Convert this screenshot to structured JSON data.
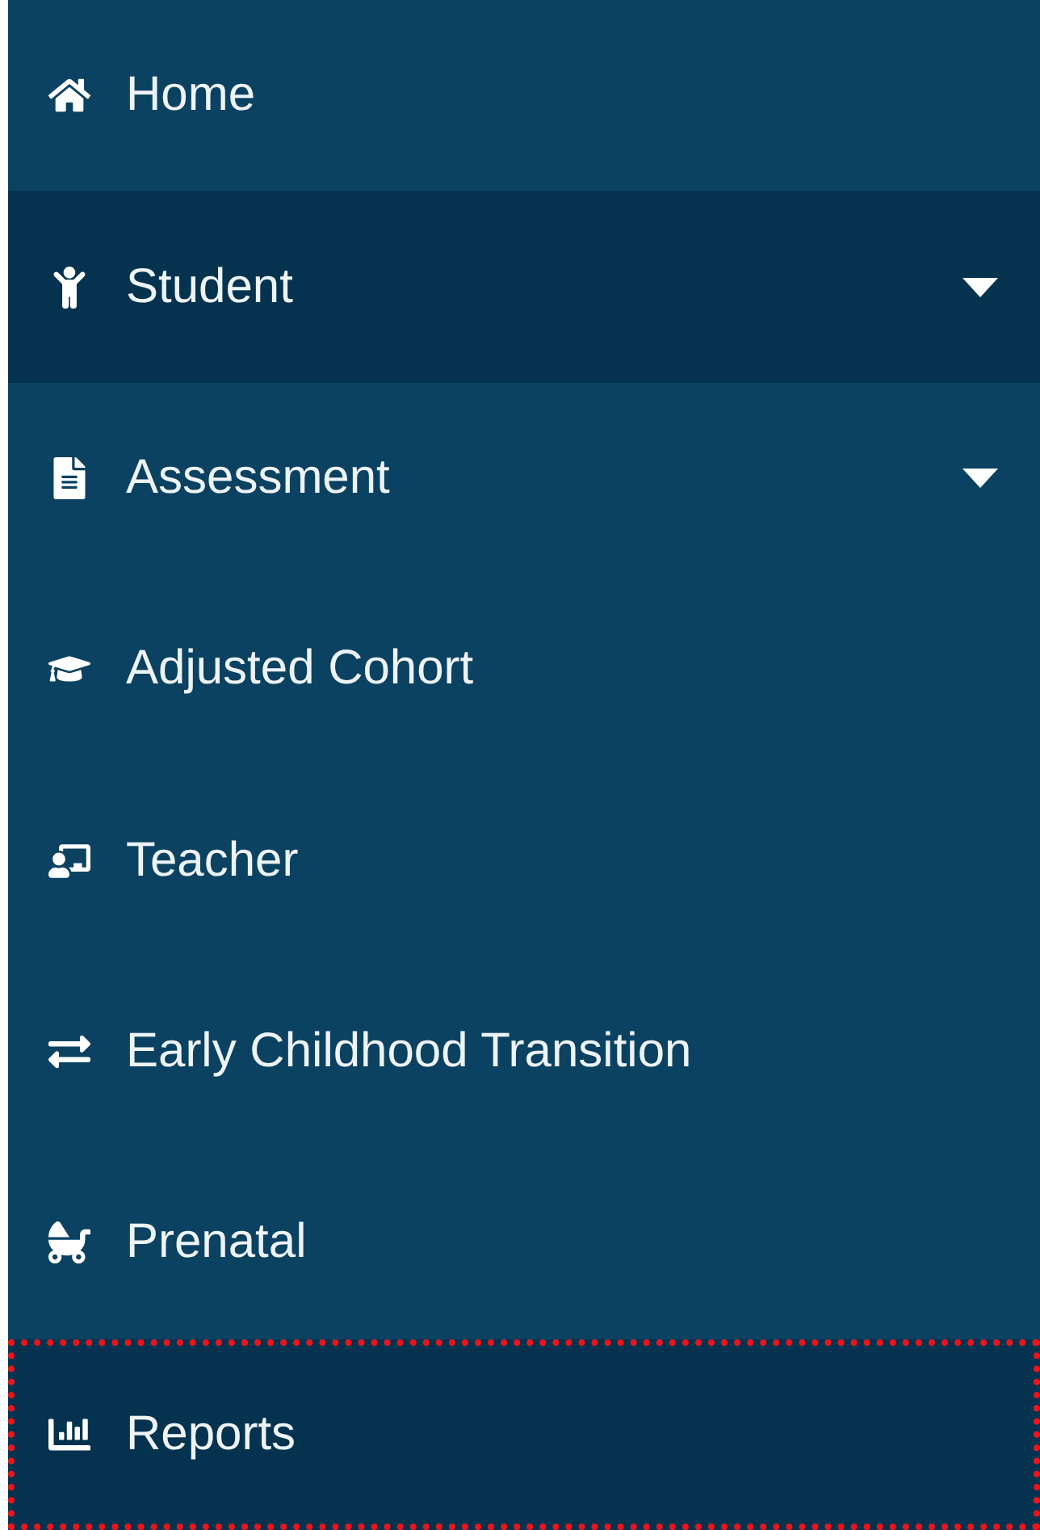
{
  "nav_items": [
    {
      "label": "Home",
      "expandable": false,
      "active": false,
      "outlined": false
    },
    {
      "label": "Student",
      "expandable": true,
      "active": true,
      "outlined": false
    },
    {
      "label": "Assessment",
      "expandable": true,
      "active": false,
      "outlined": false
    },
    {
      "label": "Adjusted Cohort",
      "expandable": false,
      "active": false,
      "outlined": false
    },
    {
      "label": "Teacher",
      "expandable": false,
      "active": false,
      "outlined": false
    },
    {
      "label": "Early Childhood Transition",
      "expandable": false,
      "active": false,
      "outlined": false
    },
    {
      "label": "Prenatal",
      "expandable": false,
      "active": false,
      "outlined": false
    },
    {
      "label": "Reports",
      "expandable": false,
      "active": true,
      "outlined": true
    }
  ]
}
